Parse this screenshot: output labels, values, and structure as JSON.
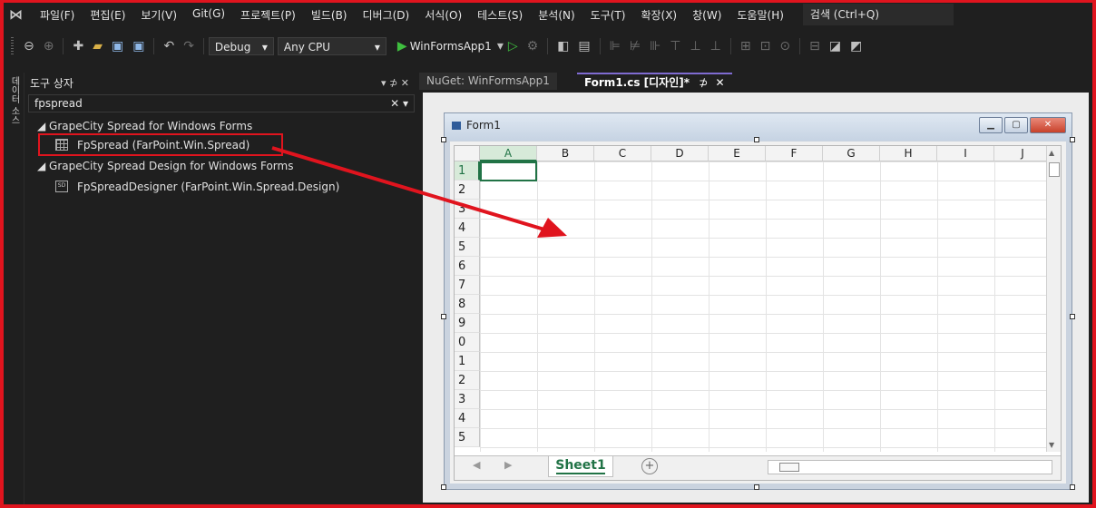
{
  "menubar": {
    "logo_icon": "visual-studio-logo-icon",
    "items": [
      "파일(F)",
      "편집(E)",
      "보기(V)",
      "Git(G)",
      "프로젝트(P)",
      "빌드(B)",
      "디버그(D)",
      "서식(O)",
      "테스트(S)",
      "분석(N)",
      "도구(T)",
      "확장(X)",
      "창(W)",
      "도움말(H)"
    ],
    "search": "검색 (Ctrl+Q)"
  },
  "toolbar": {
    "configuration": "Debug",
    "platform": "Any CPU",
    "start_target": "WinFormsApp1"
  },
  "side_strip": {
    "label": "데이터 소스"
  },
  "toolbox": {
    "title": "도구 상자",
    "controls": "▾ ⊅ ✕",
    "search_value": "fpspread",
    "groups": [
      {
        "name": "◢ GrapeCity Spread for Windows Forms",
        "items": [
          {
            "label": "FpSpread (FarPoint.Win.Spread)",
            "icon": "grid-icon"
          }
        ]
      },
      {
        "name": "◢ GrapeCity Spread Design for Windows Forms",
        "items": [
          {
            "label": "FpSpreadDesigner (FarPoint.Win.Spread.Design)",
            "icon": "sd-icon"
          }
        ]
      }
    ]
  },
  "tabs": {
    "inactive": "NuGet: WinFormsApp1",
    "active": "Form1.cs [디자인]*",
    "active_pin": "⊅",
    "active_close": "✕"
  },
  "form": {
    "title": "Form1",
    "spreadsheet": {
      "columns": [
        "A",
        "B",
        "C",
        "D",
        "E",
        "F",
        "G",
        "H",
        "I",
        "J"
      ],
      "rows": [
        "1",
        "2",
        "3",
        "4",
        "5",
        "6",
        "7",
        "8",
        "9",
        "0",
        "1",
        "2",
        "3",
        "4",
        "5"
      ],
      "active_cell": "A1",
      "sheet_tab": "Sheet1"
    }
  },
  "annotation": {
    "highlight_color": "#e0141e"
  }
}
